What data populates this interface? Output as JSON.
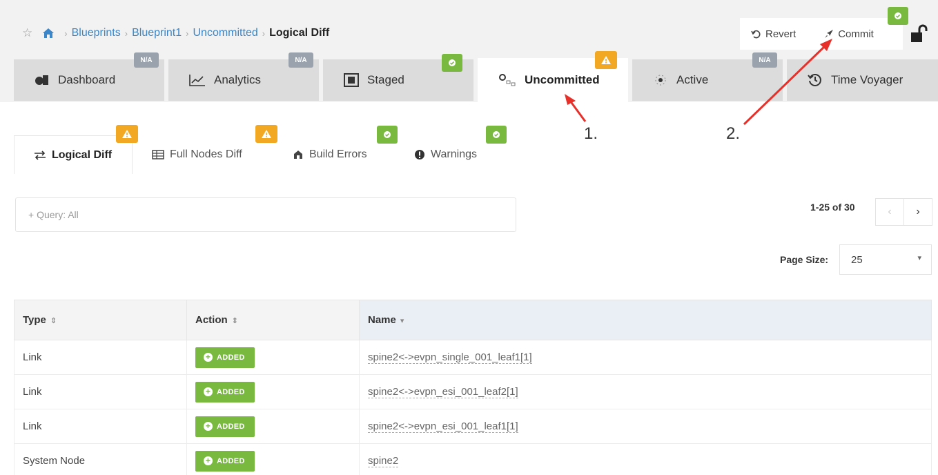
{
  "breadcrumb": {
    "items": [
      "Blueprints",
      "Blueprint1",
      "Uncommitted"
    ],
    "current": "Logical Diff"
  },
  "actions": {
    "revert_label": "Revert",
    "commit_label": "Commit"
  },
  "tabs": [
    {
      "label": "Dashboard",
      "badge": "N/A",
      "icon": "dashboard-icon"
    },
    {
      "label": "Analytics",
      "badge": "N/A",
      "icon": "analytics-chart-icon"
    },
    {
      "label": "Staged",
      "badge": "ok",
      "icon": "staged-icon"
    },
    {
      "label": "Uncommitted",
      "badge": "warning",
      "icon": "uncommitted-icon",
      "active": true
    },
    {
      "label": "Active",
      "badge": "",
      "icon": "active-icon"
    },
    {
      "label": "Time Voyager",
      "badge": "N/A",
      "icon": "history-icon"
    }
  ],
  "subtabs": [
    {
      "label": "Logical Diff",
      "badge": "warning",
      "icon": "exchange-icon",
      "active": true
    },
    {
      "label": "Full Nodes Diff",
      "badge": "warning",
      "icon": "table-icon"
    },
    {
      "label": "Build Errors",
      "badge": "ok",
      "icon": "build-icon"
    },
    {
      "label": "Warnings",
      "badge": "ok",
      "icon": "exclamation-icon"
    }
  ],
  "query": {
    "placeholder": "+ Query: All"
  },
  "pagination": {
    "info": "1-25 of 30",
    "prev": "‹",
    "next": "›"
  },
  "page_size": {
    "label": "Page Size:",
    "value": "25"
  },
  "table": {
    "headers": [
      "Type",
      "Action",
      "Name"
    ],
    "rows": [
      {
        "type": "Link",
        "action": "ADDED",
        "name": "spine2<->evpn_single_001_leaf1[1]"
      },
      {
        "type": "Link",
        "action": "ADDED",
        "name": "spine2<->evpn_esi_001_leaf2[1]"
      },
      {
        "type": "Link",
        "action": "ADDED",
        "name": "spine2<->evpn_esi_001_leaf1[1]"
      },
      {
        "type": "System Node",
        "action": "ADDED",
        "name": "spine2"
      }
    ]
  },
  "annotations": {
    "step1": "1.",
    "step2": "2."
  },
  "colors": {
    "ok": "#79b940",
    "warning": "#f2a822",
    "na": "#9aa3ad",
    "link": "#3a86c8",
    "arrow": "#e8302a"
  }
}
